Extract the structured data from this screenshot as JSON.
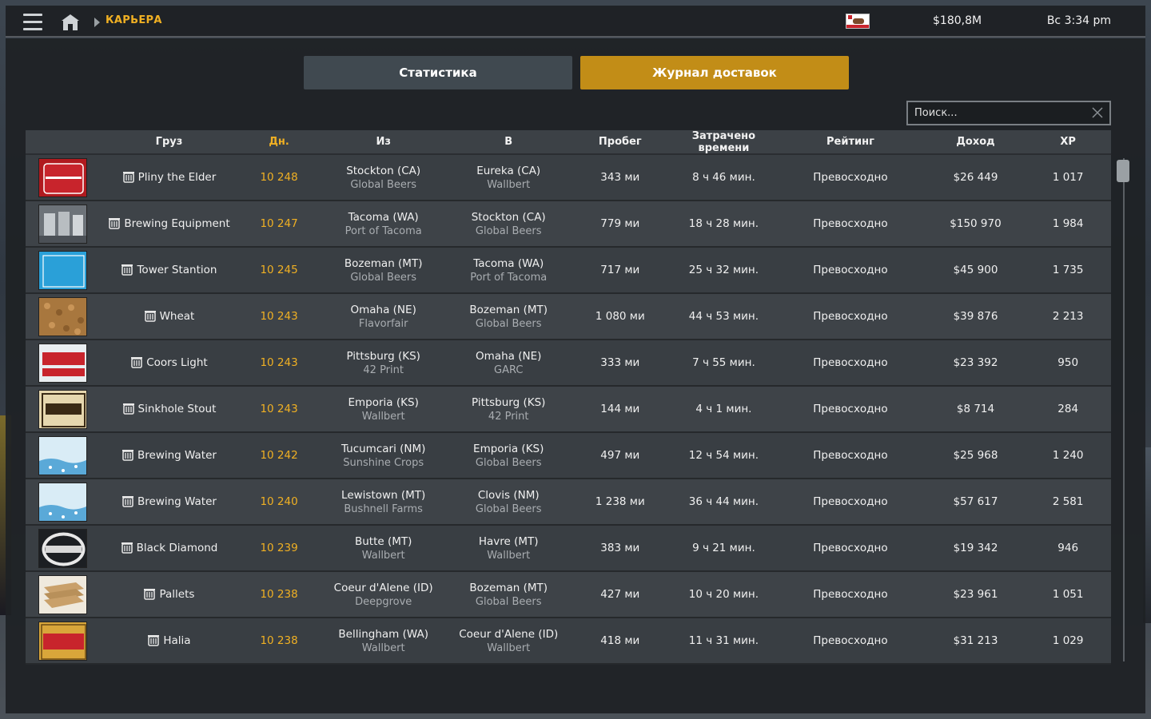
{
  "topbar": {
    "breadcrumb": "КАРЬЕРА",
    "money": "$180,8M",
    "clock": "Вс 3:34 pm"
  },
  "tabs": [
    {
      "label": "Статистика",
      "active": false
    },
    {
      "label": "Журнал доставок",
      "active": true
    }
  ],
  "search": {
    "placeholder": "Поиск...",
    "value": ""
  },
  "colors": {
    "accent": "#c28d17",
    "days": "#f0b023"
  },
  "table": {
    "columns": [
      "Груз",
      "Дн.",
      "Из",
      "В",
      "Пробег",
      "Затрачено времени",
      "Рейтинг",
      "Доход",
      "XP"
    ],
    "rows": [
      {
        "cargo": "Pliny the Elder",
        "days": "10 248",
        "from_city": "Stockton (CA)",
        "from_company": "Global Beers",
        "to_city": "Eureka (CA)",
        "to_company": "Wallbert",
        "distance": "343 ми",
        "time": "8 ч 46 мин.",
        "rating": "Превосходно",
        "income": "$26 449",
        "xp": "1 017",
        "thumb": "pliny"
      },
      {
        "cargo": "Brewing Equipment",
        "days": "10 247",
        "from_city": "Tacoma (WA)",
        "from_company": "Port of Tacoma",
        "to_city": "Stockton (CA)",
        "to_company": "Global Beers",
        "distance": "779 ми",
        "time": "18 ч 28 мин.",
        "rating": "Превосходно",
        "income": "$150 970",
        "xp": "1 984",
        "thumb": "equipment"
      },
      {
        "cargo": "Tower Stantion",
        "days": "10 245",
        "from_city": "Bozeman (MT)",
        "from_company": "Global Beers",
        "to_city": "Tacoma (WA)",
        "to_company": "Port of Tacoma",
        "distance": "717 ми",
        "time": "25 ч 32 мин.",
        "rating": "Превосходно",
        "income": "$45 900",
        "xp": "1 735",
        "thumb": "tower"
      },
      {
        "cargo": "Wheat",
        "days": "10 243",
        "from_city": "Omaha (NE)",
        "from_company": "Flavorfair",
        "to_city": "Bozeman (MT)",
        "to_company": "Global Beers",
        "distance": "1 080 ми",
        "time": "44 ч 53 мин.",
        "rating": "Превосходно",
        "income": "$39 876",
        "xp": "2 213",
        "thumb": "wheat"
      },
      {
        "cargo": "Coors Light",
        "days": "10 243",
        "from_city": "Pittsburg (KS)",
        "from_company": "42 Print",
        "to_city": "Omaha (NE)",
        "to_company": "GARC",
        "distance": "333 ми",
        "time": "7 ч 55 мин.",
        "rating": "Превосходно",
        "income": "$23 392",
        "xp": "950",
        "thumb": "coors"
      },
      {
        "cargo": "Sinkhole Stout",
        "days": "10 243",
        "from_city": "Emporia (KS)",
        "from_company": "Wallbert",
        "to_city": "Pittsburg (KS)",
        "to_company": "42 Print",
        "distance": "144 ми",
        "time": "4 ч 1 мин.",
        "rating": "Превосходно",
        "income": "$8 714",
        "xp": "284",
        "thumb": "stout"
      },
      {
        "cargo": "Brewing Water",
        "days": "10 242",
        "from_city": "Tucumcari (NM)",
        "from_company": "Sunshine Crops",
        "to_city": "Emporia (KS)",
        "to_company": "Global Beers",
        "distance": "497 ми",
        "time": "12 ч 54 мин.",
        "rating": "Превосходно",
        "income": "$25 968",
        "xp": "1 240",
        "thumb": "water"
      },
      {
        "cargo": "Brewing Water",
        "days": "10 240",
        "from_city": "Lewistown (MT)",
        "from_company": "Bushnell Farms",
        "to_city": "Clovis (NM)",
        "to_company": "Global Beers",
        "distance": "1 238 ми",
        "time": "36 ч 44 мин.",
        "rating": "Превосходно",
        "income": "$57 617",
        "xp": "2 581",
        "thumb": "water"
      },
      {
        "cargo": "Black Diamond",
        "days": "10 239",
        "from_city": "Butte (MT)",
        "from_company": "Wallbert",
        "to_city": "Havre (MT)",
        "to_company": "Wallbert",
        "distance": "383 ми",
        "time": "9 ч 21 мин.",
        "rating": "Превосходно",
        "income": "$19 342",
        "xp": "946",
        "thumb": "diamond"
      },
      {
        "cargo": "Pallets",
        "days": "10 238",
        "from_city": "Coeur d'Alene (ID)",
        "from_company": "Deepgrove",
        "to_city": "Bozeman (MT)",
        "to_company": "Global Beers",
        "distance": "427 ми",
        "time": "10 ч 20 мин.",
        "rating": "Превосходно",
        "income": "$23 961",
        "xp": "1 051",
        "thumb": "pallets"
      },
      {
        "cargo": "Halia",
        "days": "10 238",
        "from_city": "Bellingham (WA)",
        "from_company": "Wallbert",
        "to_city": "Coeur d'Alene (ID)",
        "to_company": "Wallbert",
        "distance": "418 ми",
        "time": "11 ч 31 мин.",
        "rating": "Превосходно",
        "income": "$31 213",
        "xp": "1 029",
        "thumb": "halia"
      }
    ]
  }
}
